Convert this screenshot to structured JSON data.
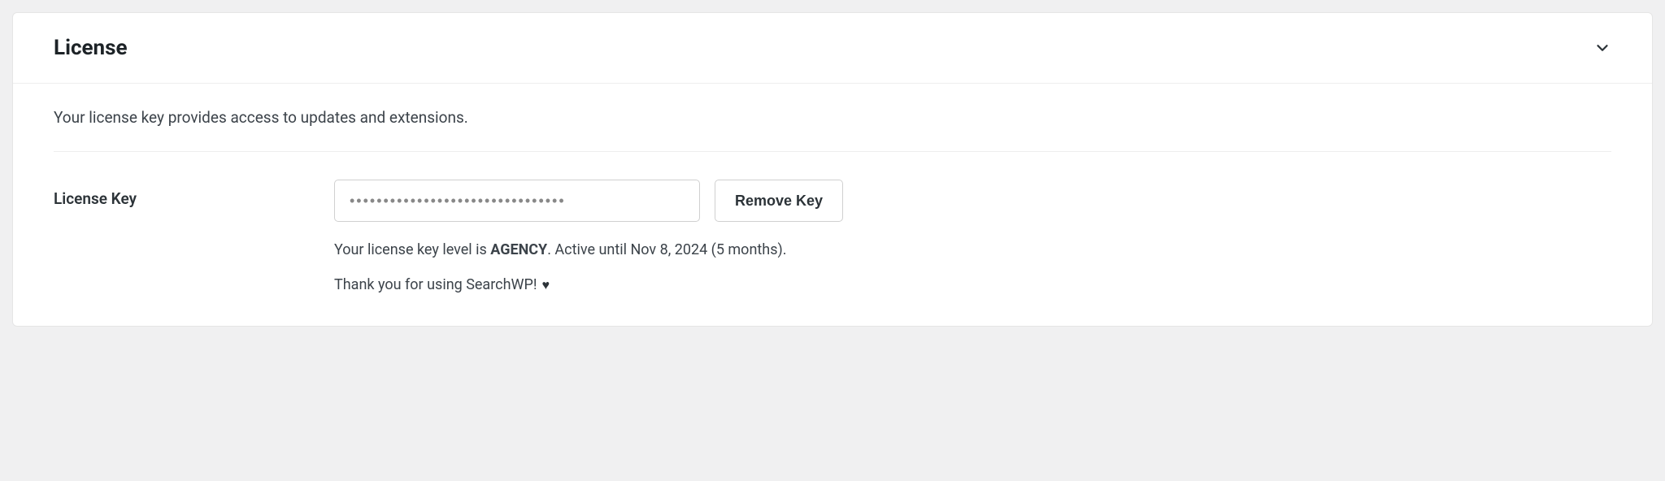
{
  "panel": {
    "title": "License",
    "description": "Your license key provides access to updates and extensions."
  },
  "license": {
    "field_label": "License Key",
    "key_masked": "••••••••••••••••••••••••••••••••",
    "remove_label": "Remove Key",
    "status_prefix": "Your license key level is ",
    "level": "AGENCY",
    "status_suffix": ". Active until Nov 8, 2024 (5 months).",
    "thanks": "Thank you for using SearchWP!"
  }
}
